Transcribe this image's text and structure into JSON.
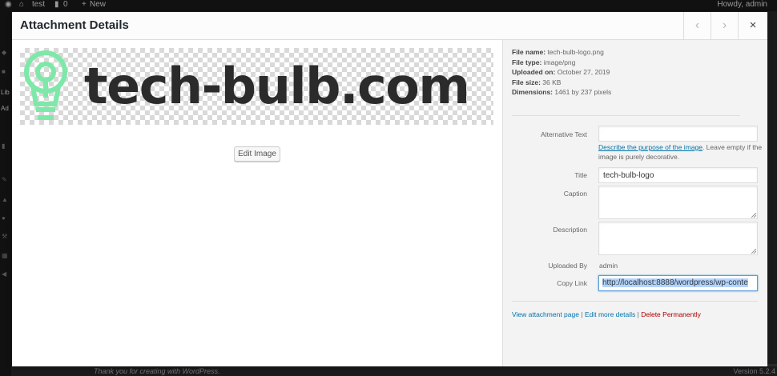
{
  "admin_bar": {
    "site_name": "test",
    "comments_count": "0",
    "new_label": "New",
    "howdy": "Howdy, admin"
  },
  "admin_menu": {
    "labels": [
      "Lib",
      "Ad"
    ]
  },
  "footer": {
    "thanks": "Thank you for creating with WordPress.",
    "version": "Version 5.2.4"
  },
  "modal": {
    "title": "Attachment Details",
    "prev_icon": "chevron-left",
    "next_icon": "chevron-right",
    "close_icon": "close-x",
    "close_glyph": "×",
    "prev_glyph": "‹",
    "next_glyph": "›"
  },
  "preview": {
    "logo_text": "tech-bulb.com",
    "logo_color": "#2b2b2b",
    "bulb_color": "#7ee8a8",
    "edit_image_label": "Edit Image"
  },
  "details": {
    "file_name_label": "File name:",
    "file_name": "tech-bulb-logo.png",
    "file_type_label": "File type:",
    "file_type": "image/png",
    "uploaded_on_label": "Uploaded on:",
    "uploaded_on": "October 27, 2019",
    "file_size_label": "File size:",
    "file_size": "36 KB",
    "dimensions_label": "Dimensions:",
    "dimensions": "1461 by 237 pixels"
  },
  "form": {
    "alt_text_label": "Alternative Text",
    "alt_text_value": "",
    "alt_help_link": "Describe the purpose of the image",
    "alt_help_rest": ". Leave empty if the image is purely decorative.",
    "title_label": "Title",
    "title_value": "tech-bulb-logo",
    "caption_label": "Caption",
    "caption_value": "",
    "description_label": "Description",
    "description_value": "",
    "uploaded_by_label": "Uploaded By",
    "uploaded_by_value": "admin",
    "copy_link_label": "Copy Link",
    "copy_link_value": "http://localhost:8888/wordpress/wp-conte"
  },
  "actions": {
    "view_attachment": "View attachment page",
    "separator": "|",
    "edit_more": "Edit more details",
    "delete": "Delete Permanently"
  },
  "colors": {
    "link": "#0073aa",
    "delete": "#aa0000",
    "focus": "#5b9dd9"
  }
}
